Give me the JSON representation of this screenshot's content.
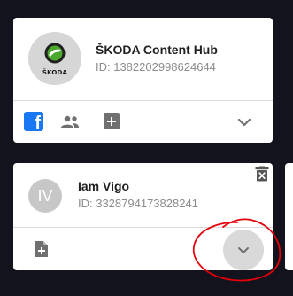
{
  "cards": [
    {
      "name": "ŠKODA Content Hub",
      "id_text": "ID: 1382202998624644",
      "logo_text": "ŠKODA",
      "actions": [
        "facebook-icon",
        "people-icon",
        "add-box-icon",
        "chevron-down-icon"
      ],
      "facebook_glyph": "f"
    },
    {
      "name": "Iam Vigo",
      "id_text": "ID: 3328794173828241",
      "initials": "IV",
      "actions": [
        "delete-icon",
        "add-page-icon",
        "chevron-down-icon"
      ]
    }
  ],
  "colors": {
    "background": "#12131c",
    "card": "#ffffff",
    "facebook": "#1877f2",
    "icon_gray": "#707070",
    "annotation": "#e3000b",
    "skoda_green": "#4ba82e"
  }
}
